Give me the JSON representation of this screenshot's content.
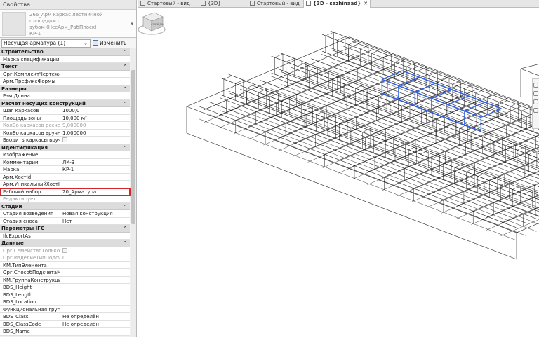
{
  "panel": {
    "title": "Свойства",
    "type_lines": [
      "266_Арм каркас лестничной площадки с",
      "зубом (НесАрм_РабПлоск)",
      "КР-1"
    ],
    "instance_filter": "Несущая арматура (1)",
    "edit_type": "Изменить тип",
    "groups": [
      {
        "label": "Строительство",
        "rows": [
          {
            "k": "Марка спецификации",
            "v": ""
          }
        ]
      },
      {
        "label": "Текст",
        "rows": [
          {
            "k": "Орг.КомплектЧертежей",
            "v": ""
          },
          {
            "k": "Арм.ПрефиксФормы",
            "v": ""
          }
        ]
      },
      {
        "label": "Размеры",
        "rows": [
          {
            "k": "Рзм.Длина",
            "v": ""
          }
        ]
      },
      {
        "label": "Расчет несущих конструкций",
        "rows": [
          {
            "k": "Шаг каркасов",
            "v": "1000,0"
          },
          {
            "k": "Площадь зоны",
            "v": "10,000 м²"
          },
          {
            "k": "КолВо каркасов расчет...",
            "v": "9,000000",
            "dim": true
          },
          {
            "k": "КолВо каркасов вручную",
            "v": "1,000000"
          },
          {
            "k": "Вводить каркасы вручн...",
            "v": "",
            "cb": true
          }
        ]
      },
      {
        "label": "Идентификация",
        "rows": [
          {
            "k": "Изображение",
            "v": ""
          },
          {
            "k": "Комментарии",
            "v": "ЛК-3"
          },
          {
            "k": "Марка",
            "v": "КР-1"
          },
          {
            "k": "Арм.ХостId",
            "v": ""
          },
          {
            "k": "Арм.УникальныйХостId",
            "v": ""
          },
          {
            "k": "Рабочий набор",
            "v": "20_Арматура",
            "hl": true
          },
          {
            "k": "Редактирует",
            "v": "",
            "dim": true
          }
        ]
      },
      {
        "label": "Стадии",
        "rows": [
          {
            "k": "Стадия возведения",
            "v": "Новая конструкция"
          },
          {
            "k": "Стадия сноса",
            "v": "Нет"
          }
        ]
      },
      {
        "label": "Параметры IFC",
        "rows": [
          {
            "k": "IfcExportAs",
            "v": ""
          }
        ]
      },
      {
        "label": "Данные",
        "rows": [
          {
            "k": "Орг.СемействоТолькоВ...",
            "v": "",
            "cb": true,
            "dim": true
          },
          {
            "k": "Орг.ИзделиеТипПодсче...",
            "v": "0",
            "dim": true
          },
          {
            "k": "КМ.ТипЭлемента",
            "v": ""
          },
          {
            "k": "Орг.СпособПодсчетаМ...",
            "v": ""
          },
          {
            "k": "КМ.ГруппаКонструкций",
            "v": ""
          },
          {
            "k": "BDS_Height",
            "v": ""
          },
          {
            "k": "BDS_Length",
            "v": ""
          },
          {
            "k": "BDS_Location",
            "v": ""
          },
          {
            "k": "Функциональная групп...",
            "v": ""
          },
          {
            "k": "BDS_Class",
            "v": "Не определён"
          },
          {
            "k": "BDS_ClassCode",
            "v": "Не определён"
          },
          {
            "k": "BDS_Name",
            "v": ""
          }
        ]
      }
    ]
  },
  "tabs": [
    {
      "label": "Стартовый - вид",
      "active": false
    },
    {
      "label": "{3D}",
      "active": false
    },
    {
      "label": "Стартовый - вид",
      "active": false
    },
    {
      "label": "{3D - sazhinaad}",
      "active": true,
      "close": "✕"
    }
  ],
  "viewcube": {
    "face_label": "СПЕРЕДИ"
  },
  "colors": {
    "selection": "#2f5fe0",
    "highlight": "#d0282b",
    "wire": "#1a1a1a"
  }
}
